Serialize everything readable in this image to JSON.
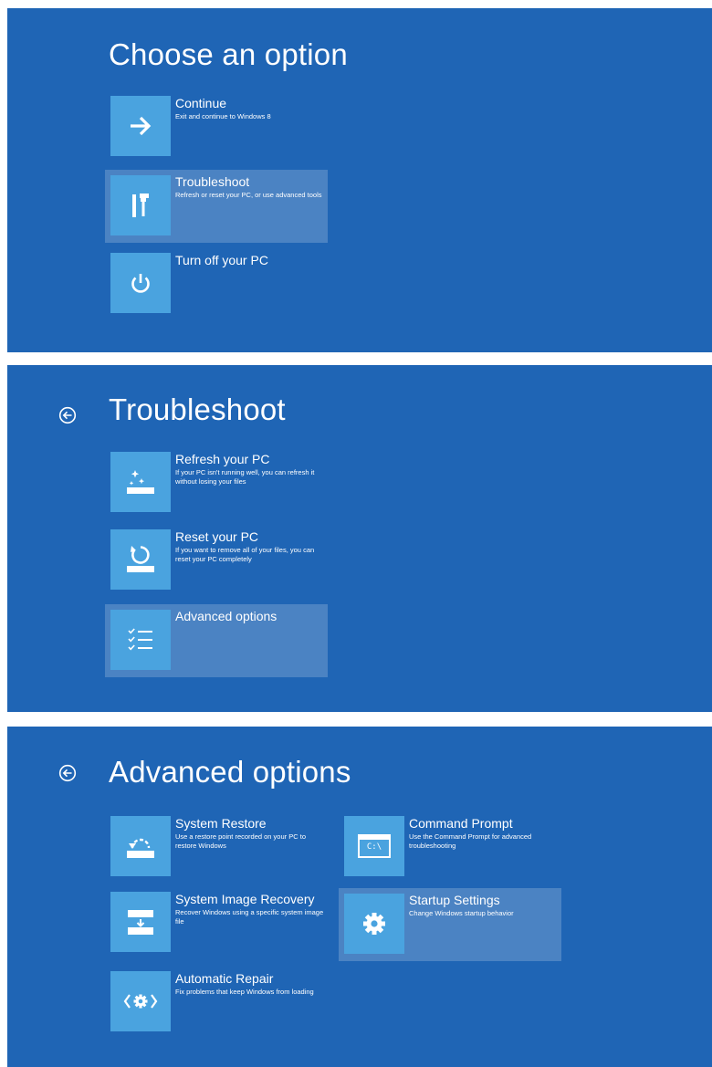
{
  "panel1": {
    "title": "Choose an option",
    "options": [
      {
        "icon": "arrow-right-icon",
        "title": "Continue",
        "desc": "Exit and continue to Windows 8"
      },
      {
        "icon": "tools-icon",
        "title": "Troubleshoot",
        "desc": "Refresh or reset your PC, or use advanced tools"
      },
      {
        "icon": "power-icon",
        "title": "Turn off your PC",
        "desc": ""
      }
    ]
  },
  "panel2": {
    "title": "Troubleshoot",
    "back_icon": "back-arrow-icon",
    "options": [
      {
        "icon": "refresh-pc-icon",
        "title": "Refresh your PC",
        "desc": "If your PC isn't running well, you can refresh it without losing your files"
      },
      {
        "icon": "reset-pc-icon",
        "title": "Reset your PC",
        "desc": "If you want to remove all of your files, you can reset your PC completely"
      },
      {
        "icon": "checklist-icon",
        "title": "Advanced options",
        "desc": ""
      }
    ]
  },
  "panel3": {
    "title": "Advanced options",
    "back_icon": "back-arrow-icon",
    "options": [
      {
        "icon": "system-restore-icon",
        "title": "System Restore",
        "desc": "Use a restore point recorded on your PC to restore Windows"
      },
      {
        "icon": "command-prompt-icon",
        "title": "Command Prompt",
        "desc": "Use the Command Prompt for advanced troubleshooting",
        "tile_text": "C:\\"
      },
      {
        "icon": "system-image-icon",
        "title": "System Image Recovery",
        "desc": "Recover Windows using a specific system image file"
      },
      {
        "icon": "gear-icon",
        "title": "Startup Settings",
        "desc": "Change Windows startup behavior"
      },
      {
        "icon": "automatic-repair-icon",
        "title": "Automatic Repair",
        "desc": "Fix problems that keep Windows from loading"
      }
    ]
  },
  "colors": {
    "background": "#1f65b5",
    "tile": "#4aa3df",
    "selected": "rgba(255,255,255,0.2)",
    "text": "#ffffff"
  }
}
